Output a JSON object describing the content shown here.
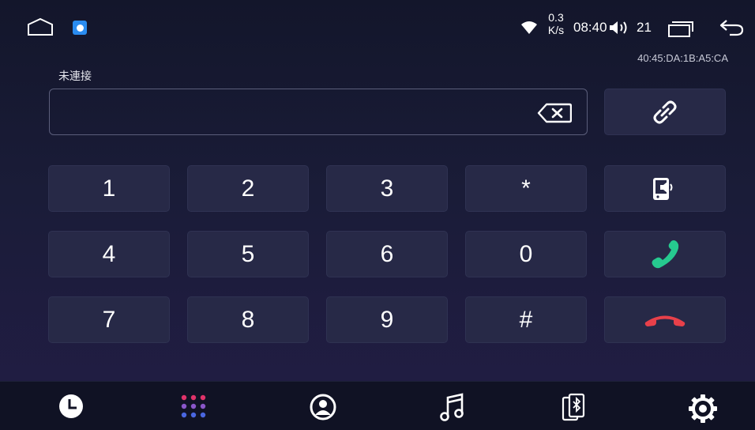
{
  "status_bar": {
    "net_speed_value": "0.3",
    "net_speed_unit": "K/s",
    "time": "08:40",
    "volume": "21"
  },
  "device": {
    "mac_address": "40:45:DA:1B:A5:CA",
    "connection_status": "未連接"
  },
  "dialer": {
    "number_value": "",
    "keys": {
      "k1": "1",
      "k2": "2",
      "k3": "3",
      "star": "*",
      "k4": "4",
      "k5": "5",
      "k6": "6",
      "k0": "0",
      "k7": "7",
      "k8": "8",
      "k9": "9",
      "hash": "#"
    }
  },
  "colors": {
    "call_green": "#26c98f",
    "hangup_red": "#e8404a",
    "key_bg": "#272947",
    "dots_top": "#e0336a",
    "dots_mid": "#8a56c9",
    "dots_bottom": "#4a66e0"
  },
  "icons": {
    "home": "home-icon",
    "bluetooth_app": "bluetooth-app-icon",
    "wifi": "wifi-icon",
    "volume": "volume-icon",
    "recents": "recent-apps-icon",
    "back": "back-icon",
    "backspace": "backspace-icon",
    "link": "link-icon",
    "audio_switch": "audio-transfer-icon",
    "call": "call-icon",
    "hangup": "hangup-icon",
    "tab_history": "clock-icon",
    "tab_dialpad": "dialpad-icon",
    "tab_contacts": "contacts-icon",
    "tab_music": "music-icon",
    "tab_bt_device": "bluetooth-phone-icon",
    "tab_settings": "gear-icon"
  }
}
